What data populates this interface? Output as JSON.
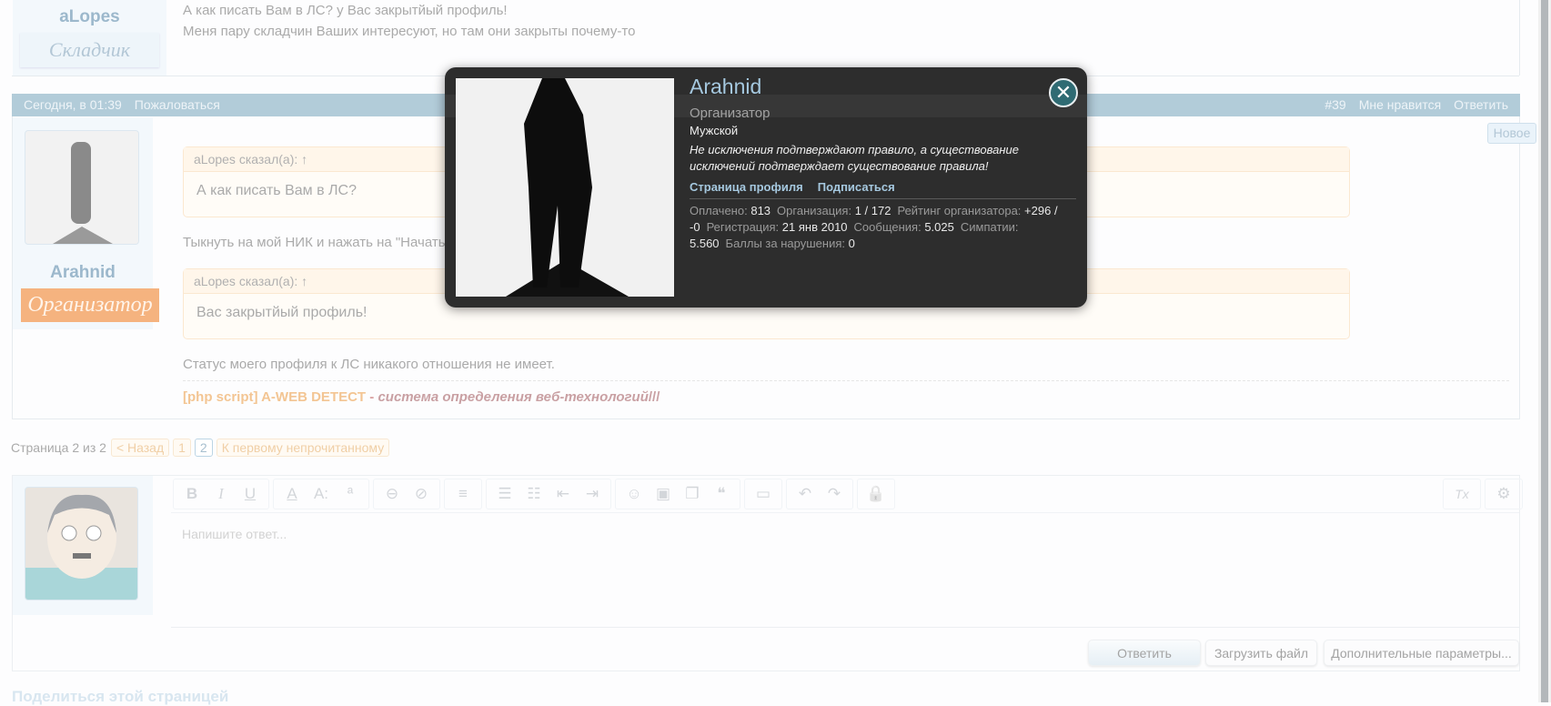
{
  "prev_post": {
    "username": "aLopes",
    "user_title": "Складчик",
    "lines": [
      "А как писать Вам в ЛС? у Вас закрытйый профиль!",
      "Меня пару складчин Ваших интересуют, но там они закрыты почему-то"
    ]
  },
  "post": {
    "date": "Сегодня, в 01:39",
    "report": "Пожаловаться",
    "number": "#39",
    "like": "Мне нравится",
    "reply": "Ответить",
    "new_badge": "Новое",
    "username": "Arahnid",
    "user_title": "Организатор",
    "quotes": [
      {
        "header": "aLopes сказал(а): ↑",
        "body": "А как писать Вам в ЛС?"
      },
      {
        "header": "aLopes сказал(а): ↑",
        "body": "Вас закрытйый профиль!"
      }
    ],
    "text1": "Тыкнуть на мой НИК и нажать на \"Начать",
    "text2": "Статус моего профиля к ЛС никакого отношения не имеет.",
    "signature_link": "[php script] A-WEB DETECT",
    "signature_sep": " - ",
    "signature_text": "система определения веб-технологий",
    "signature_tail": "///"
  },
  "pagination": {
    "label": "Страница 2 из 2",
    "prev": "< Назад",
    "pages": [
      "1",
      "2"
    ],
    "current": "2",
    "first_unread": "К первому непрочитанному"
  },
  "editor": {
    "placeholder": "Напишите ответ...",
    "toolbar": [
      [
        "bold-icon",
        "B"
      ],
      [
        "italic-icon",
        "I"
      ],
      [
        "underline-icon",
        "U"
      ],
      [
        "font-color-icon",
        "A"
      ],
      [
        "font-size-icon",
        "A:"
      ],
      [
        "font-family-icon",
        "ª"
      ],
      [
        "link-icon",
        "⊖"
      ],
      [
        "unlink-icon",
        "⊘"
      ],
      [
        "align-icon",
        "≡"
      ],
      [
        "bullet-list-icon",
        "☰"
      ],
      [
        "number-list-icon",
        "☷"
      ],
      [
        "outdent-icon",
        "⇤"
      ],
      [
        "indent-icon",
        "⇥"
      ],
      [
        "smilie-icon",
        "☺"
      ],
      [
        "image-icon",
        "▣"
      ],
      [
        "media-icon",
        "❐"
      ],
      [
        "quote-icon",
        "❝"
      ],
      [
        "save-icon",
        "▭"
      ],
      [
        "undo-icon",
        "↶"
      ],
      [
        "redo-icon",
        "↷"
      ],
      [
        "lock-icon",
        "🔒"
      ],
      [
        "remove-format-icon",
        "Tx"
      ],
      [
        "settings-icon",
        "⚙"
      ]
    ],
    "reply_button": "Ответить",
    "upload_button": "Загрузить файл",
    "more_button": "Дополнительные параметры..."
  },
  "share_heading": "Поделиться этой страницей",
  "popup": {
    "name": "Arahnid",
    "title": "Организатор",
    "gender": "Мужской",
    "status": "Не исключения подтверждают правило, а существование исключений подтверждает существование правила!",
    "profile_link": "Страница профиля",
    "follow_link": "Подписаться",
    "stats": [
      {
        "label": "Оплачено:",
        "value": "813"
      },
      {
        "label": "Организация:",
        "value": "1 / 172"
      },
      {
        "label": "Рейтинг организатора:",
        "value": "+296 / -0"
      },
      {
        "label": "Регистрация:",
        "value": "21 янв 2010"
      },
      {
        "label": "Сообщения:",
        "value": "5.025"
      },
      {
        "label": "Симпатии:",
        "value": "5.560"
      },
      {
        "label": "Баллы за нарушения:",
        "value": "0"
      }
    ]
  }
}
